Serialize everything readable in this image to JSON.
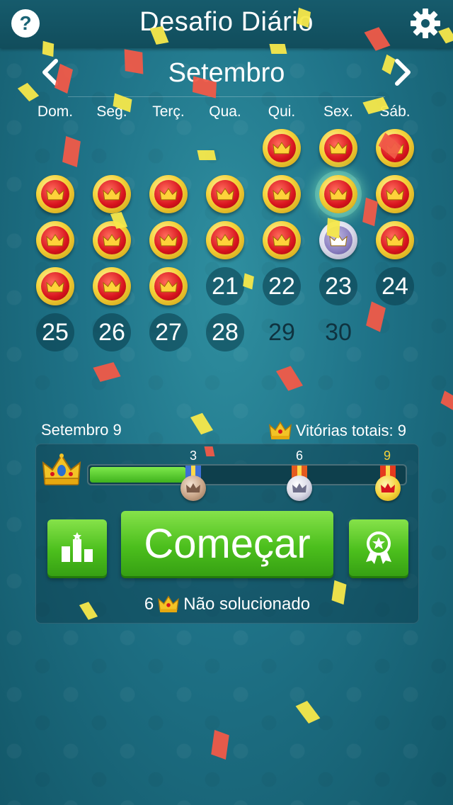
{
  "header": {
    "title": "Desafio Diário",
    "help_label": "?",
    "settings_icon": "gear-icon"
  },
  "month_nav": {
    "prev_icon": "chevron-left-icon",
    "next_icon": "chevron-right-icon",
    "month": "Setembro"
  },
  "weekdays": [
    "Dom.",
    "Seg.",
    "Terç.",
    "Qua.",
    "Qui.",
    "Sex.",
    "Sáb."
  ],
  "calendar": {
    "days": [
      {
        "day": 1,
        "status": "won"
      },
      {
        "day": 2,
        "status": "won"
      },
      {
        "day": 3,
        "status": "won"
      },
      {
        "day": 4,
        "status": "won"
      },
      {
        "day": 5,
        "status": "won"
      },
      {
        "day": 6,
        "status": "won"
      },
      {
        "day": 7,
        "status": "won"
      },
      {
        "day": 8,
        "status": "won"
      },
      {
        "day": 9,
        "status": "won",
        "today": true
      },
      {
        "day": 10,
        "status": "won"
      },
      {
        "day": 11,
        "status": "won"
      },
      {
        "day": 12,
        "status": "won"
      },
      {
        "day": 13,
        "status": "won"
      },
      {
        "day": 14,
        "status": "won"
      },
      {
        "day": 15,
        "status": "won"
      },
      {
        "day": 16,
        "status": "silver"
      },
      {
        "day": 17,
        "status": "won"
      },
      {
        "day": 18,
        "status": "won"
      },
      {
        "day": 19,
        "status": "won"
      },
      {
        "day": 20,
        "status": "won"
      },
      {
        "day": 21,
        "status": "number"
      },
      {
        "day": 22,
        "status": "number"
      },
      {
        "day": 23,
        "status": "number"
      },
      {
        "day": 24,
        "status": "number"
      },
      {
        "day": 25,
        "status": "number"
      },
      {
        "day": 26,
        "status": "number"
      },
      {
        "day": 27,
        "status": "number"
      },
      {
        "day": 28,
        "status": "number"
      },
      {
        "day": 29,
        "status": "future"
      },
      {
        "day": 30,
        "status": "future"
      }
    ]
  },
  "stats": {
    "date_label": "Setembro 9",
    "total_wins_label": "Vitórias totais: 9"
  },
  "progress": {
    "value": 3,
    "max": 9,
    "milestones": [
      {
        "label": "3",
        "tier": "bronze"
      },
      {
        "label": "6",
        "tier": "silver"
      },
      {
        "label": "9",
        "tier": "gold"
      }
    ]
  },
  "buttons": {
    "start_label": "Começar",
    "stats_icon": "leaderboard-icon",
    "award_icon": "award-ribbon-icon"
  },
  "unsolved": {
    "count": "6",
    "label": "Não solucionado"
  },
  "colors": {
    "accent_green": "#4cbf1d",
    "coin_red": "#d8141e",
    "coin_gold": "#f4d23a",
    "background": "#1f7388"
  }
}
